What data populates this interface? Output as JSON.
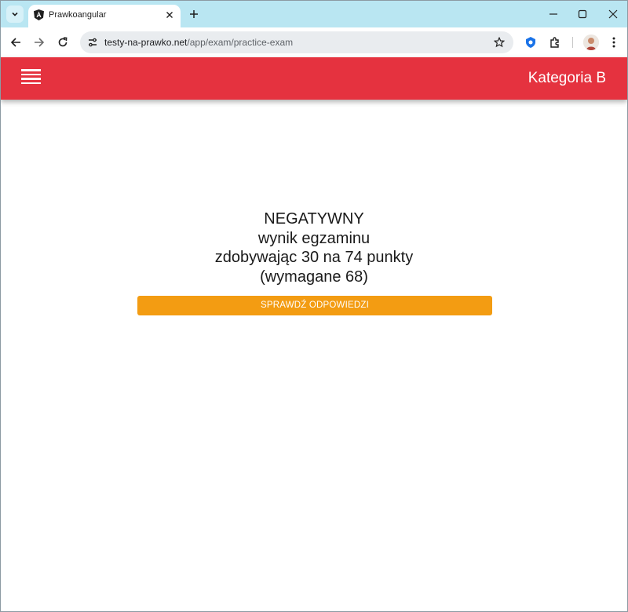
{
  "browser": {
    "tab": {
      "title": "Prawkoangular"
    },
    "address": {
      "domain": "testy-na-prawko.net",
      "path": "/app/exam/practice-exam"
    }
  },
  "app": {
    "header_title": "Kategoria B",
    "header_color": "#e5323f"
  },
  "result": {
    "status": "NEGATYWNY",
    "line2": "wynik egzaminu",
    "line3": "zdobywając 30 na 74 punkty",
    "line4": "(wymagane 68)"
  },
  "actions": {
    "check_answers_label": "SPRAWDŹ ODPOWIEDZI",
    "button_color": "#f39c12"
  },
  "icons": [
    "tab-search-icon",
    "angular-favicon-icon",
    "close-icon",
    "plus-icon",
    "minimize-icon",
    "maximize-icon",
    "window-close-icon",
    "back-arrow-icon",
    "forward-arrow-icon",
    "reload-icon",
    "site-info-icon",
    "star-icon",
    "extension-shield-icon",
    "puzzle-icon",
    "more-vert-icon",
    "hamburger-menu-icon"
  ]
}
